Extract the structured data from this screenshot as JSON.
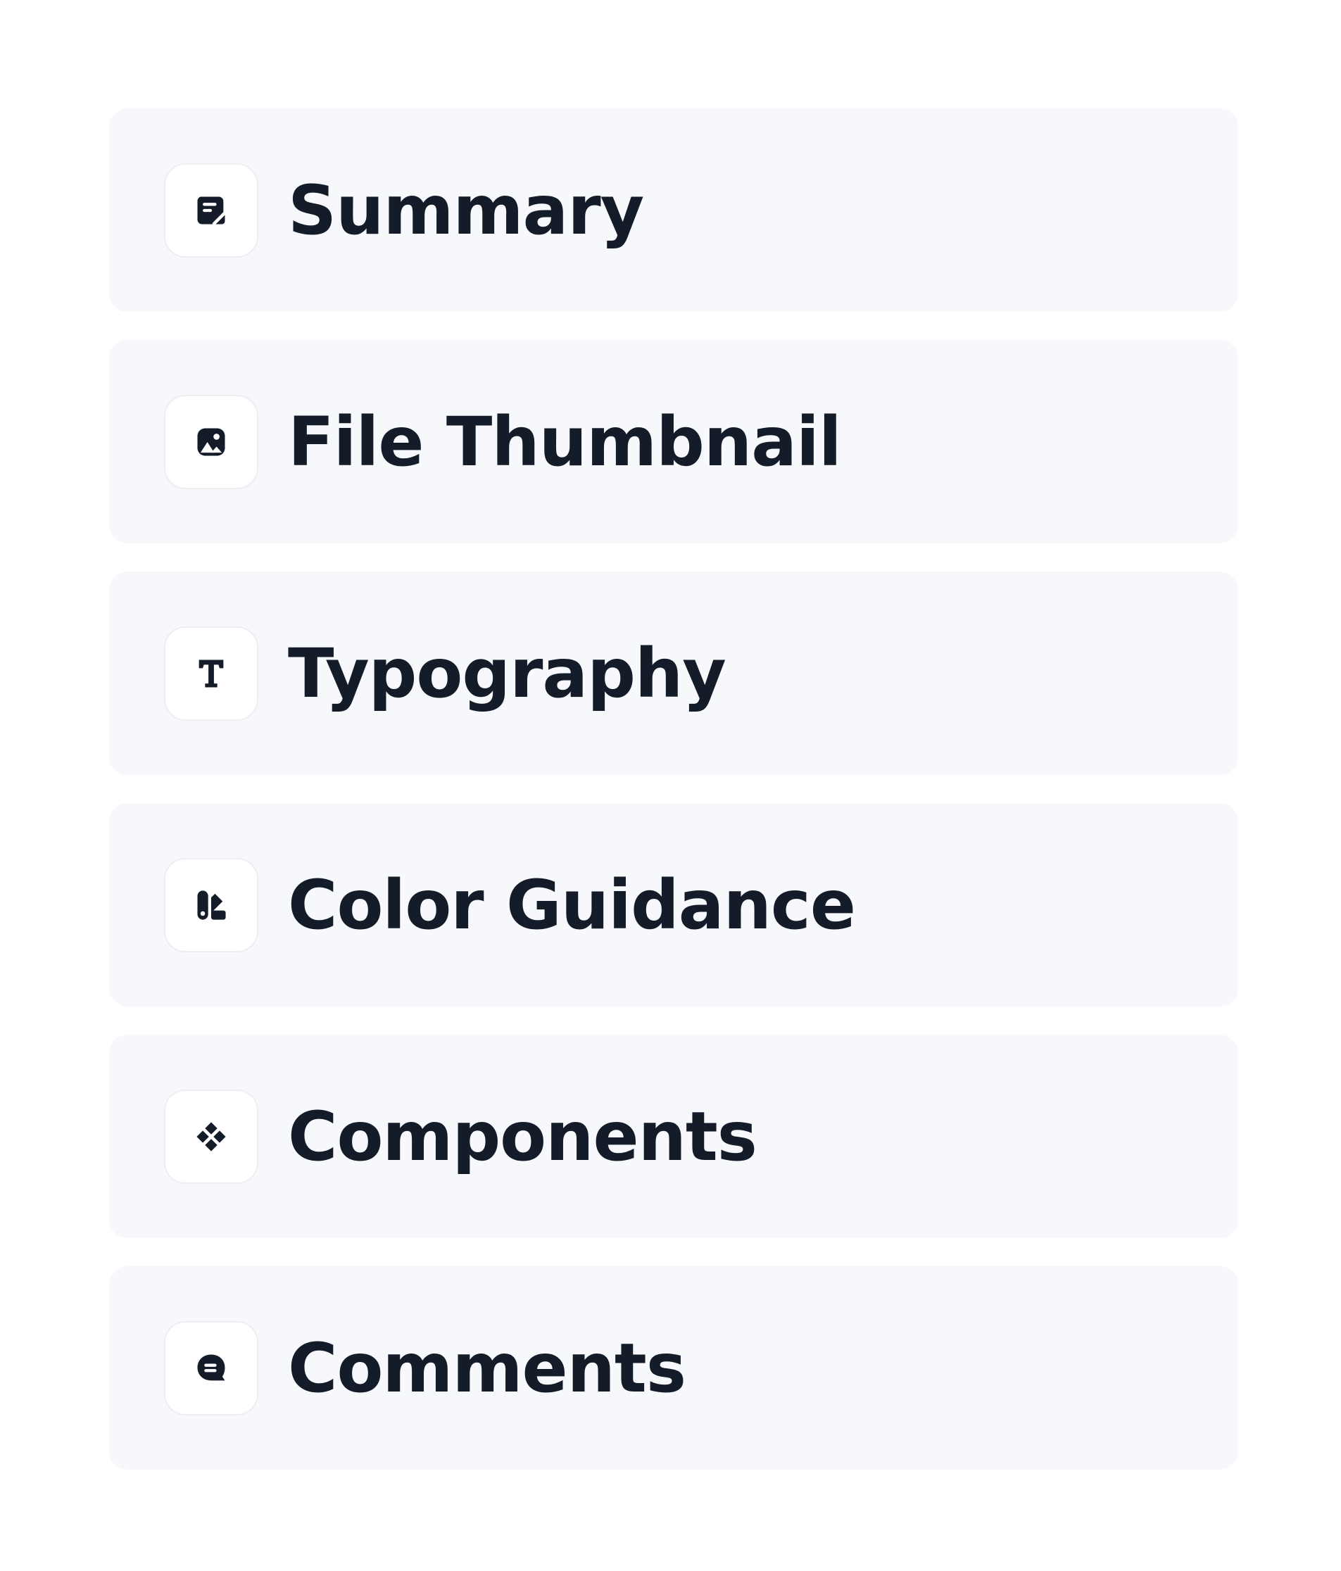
{
  "items": [
    {
      "label": "Summary",
      "icon": "note-icon"
    },
    {
      "label": "File Thumbnail",
      "icon": "image-icon"
    },
    {
      "label": "Typography",
      "icon": "text-icon"
    },
    {
      "label": "Color Guidance",
      "icon": "swatch-icon"
    },
    {
      "label": "Components",
      "icon": "components-icon"
    },
    {
      "label": "Comments",
      "icon": "comment-icon"
    }
  ],
  "colors": {
    "card_background": "#f7f8fc",
    "text": "#131c28",
    "icon_box": "#ffffff"
  }
}
